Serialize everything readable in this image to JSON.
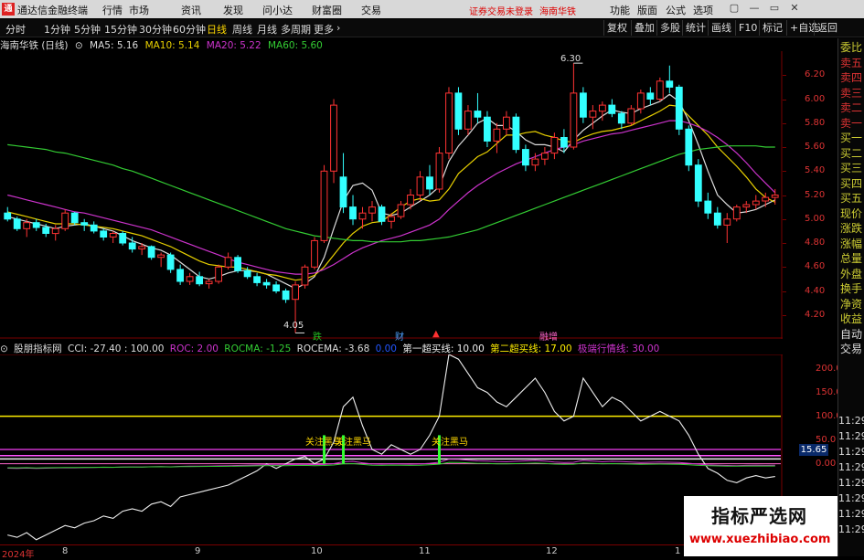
{
  "titlebar": {
    "logo_text": "通",
    "app_name": "通达信金融终端",
    "menus": [
      "行情",
      "市场",
      "资讯",
      "发现",
      "问小达",
      "财富圈",
      "交易"
    ],
    "warning": "证券交易未登录",
    "stock_title": "海南华铁",
    "right_menus": [
      "功能",
      "版面",
      "公式",
      "选项"
    ],
    "window_buttons": [
      "▢",
      "—",
      "▭",
      "✕"
    ]
  },
  "toolbar": {
    "periods": [
      "分时",
      "1分钟",
      "5分钟",
      "15分钟",
      "30分钟",
      "60分钟",
      "日线",
      "周线",
      "月线",
      "多周期",
      "更多"
    ],
    "active_period": "日线",
    "right_buttons": [
      "复权",
      "叠加",
      "多股",
      "统计",
      "画线",
      "F10",
      "标记",
      "+自选",
      "返回"
    ]
  },
  "main_info": {
    "name": "海南华铁 (日线)",
    "ma5": "MA5: 5.16",
    "ma10": "MA10: 5.14",
    "ma20": "MA20: 5.22",
    "ma60": "MA60: 5.60"
  },
  "price_axis": {
    "ticks": [
      6.2,
      6.0,
      5.8,
      5.6,
      5.4,
      5.2,
      5.0,
      4.8,
      4.6,
      4.4,
      4.2
    ],
    "tick_labels": [
      "6.20",
      "6.00",
      "5.80",
      "5.60",
      "5.40",
      "5.20",
      "5.00",
      "4.80",
      "4.60",
      "4.40",
      "4.20"
    ],
    "range": [
      4.0,
      6.4
    ]
  },
  "main_annotations": {
    "high": "6.30",
    "low": "4.05",
    "markers": [
      {
        "text": "跌",
        "color": "#22c022"
      },
      {
        "text": "财",
        "color": "#4aa0ff"
      },
      {
        "text": "▲",
        "color": "#ff3030"
      },
      {
        "text": "融增",
        "color": "#ff66cc"
      }
    ]
  },
  "indicator_info": {
    "name": "股朋指标网",
    "cci": "CCI: -27.40 : 100.00",
    "roc": "ROC: 2.00",
    "rocma": "ROCMA: -1.25",
    "rocema": "ROCEMA: -3.68",
    "val_blue": "0.00",
    "line1": "第一超买线: 10.00",
    "line2": "第二超买线: 17.00",
    "line3": "极端行情线: 30.00"
  },
  "indicator_axis": {
    "ticks": [
      200,
      150,
      100,
      50,
      0
    ],
    "tick_labels": [
      "200.0",
      "150.0",
      "100.0",
      "50.0",
      "0.00"
    ],
    "range": [
      -170,
      230
    ],
    "badge": "15.65"
  },
  "indicator_annotations": {
    "signal_label": "关注黑马"
  },
  "dates": [
    "2024年",
    "8",
    "9",
    "10",
    "11",
    "12",
    "1"
  ],
  "sidebar": {
    "labels": [
      "委比",
      "卖五",
      "卖四",
      "卖三",
      "卖二",
      "卖一",
      "买一",
      "买二",
      "买三",
      "买四",
      "买五",
      "现价",
      "涨跌",
      "涨幅",
      "总量",
      "外盘",
      "换手",
      "净资",
      "收益",
      "自动",
      "交易"
    ],
    "times": [
      "11:29",
      "11:29",
      "11:29",
      "11:29",
      "11:29",
      "11:29",
      "11:29",
      "11:29"
    ]
  },
  "watermark": {
    "title": "指标严选网",
    "url": "www.xuezhibiao.com"
  },
  "chart_data": {
    "type": "candlestick",
    "title": "海南华铁 (日线)",
    "ylim": [
      4.0,
      6.4
    ],
    "candles": [
      [
        5.05,
        5.1,
        4.98,
        5.0
      ],
      [
        5.0,
        5.02,
        4.9,
        4.92
      ],
      [
        4.92,
        5.0,
        4.85,
        4.97
      ],
      [
        4.97,
        5.0,
        4.9,
        4.93
      ],
      [
        4.93,
        4.96,
        4.85,
        4.88
      ],
      [
        4.88,
        4.95,
        4.82,
        4.92
      ],
      [
        4.92,
        5.08,
        4.9,
        5.05
      ],
      [
        5.05,
        5.06,
        4.95,
        4.97
      ],
      [
        4.97,
        5.0,
        4.9,
        4.95
      ],
      [
        4.95,
        4.98,
        4.88,
        4.9
      ],
      [
        4.9,
        4.92,
        4.82,
        4.85
      ],
      [
        4.85,
        4.9,
        4.8,
        4.88
      ],
      [
        4.88,
        4.9,
        4.78,
        4.8
      ],
      [
        4.8,
        4.85,
        4.72,
        4.75
      ],
      [
        4.75,
        4.8,
        4.7,
        4.77
      ],
      [
        4.77,
        4.78,
        4.66,
        4.68
      ],
      [
        4.68,
        4.72,
        4.6,
        4.7
      ],
      [
        4.7,
        4.72,
        4.55,
        4.58
      ],
      [
        4.58,
        4.62,
        4.45,
        4.48
      ],
      [
        4.48,
        4.55,
        4.45,
        4.52
      ],
      [
        4.52,
        4.56,
        4.44,
        4.46
      ],
      [
        4.46,
        4.5,
        4.42,
        4.48
      ],
      [
        4.48,
        4.62,
        4.46,
        4.6
      ],
      [
        4.6,
        4.72,
        4.58,
        4.68
      ],
      [
        4.68,
        4.7,
        4.55,
        4.57
      ],
      [
        4.57,
        4.6,
        4.5,
        4.52
      ],
      [
        4.52,
        4.55,
        4.44,
        4.47
      ],
      [
        4.47,
        4.5,
        4.42,
        4.45
      ],
      [
        4.45,
        4.48,
        4.38,
        4.4
      ],
      [
        4.4,
        4.42,
        4.3,
        4.33
      ],
      [
        4.33,
        4.48,
        4.05,
        4.45
      ],
      [
        4.45,
        4.62,
        4.42,
        4.6
      ],
      [
        4.6,
        4.85,
        4.58,
        4.82
      ],
      [
        4.82,
        5.45,
        4.8,
        5.4
      ],
      [
        5.4,
        6.0,
        5.3,
        5.95
      ],
      [
        5.35,
        5.55,
        5.05,
        5.1
      ],
      [
        5.1,
        5.2,
        4.95,
        5.0
      ],
      [
        5.0,
        5.1,
        4.92,
        5.05
      ],
      [
        5.05,
        5.15,
        4.98,
        5.1
      ],
      [
        5.1,
        5.12,
        4.95,
        4.98
      ],
      [
        4.98,
        5.05,
        4.92,
        5.02
      ],
      [
        5.02,
        5.15,
        5.0,
        5.12
      ],
      [
        5.12,
        5.25,
        5.08,
        5.2
      ],
      [
        5.2,
        5.4,
        5.15,
        5.35
      ],
      [
        5.35,
        5.45,
        5.2,
        5.25
      ],
      [
        5.25,
        5.6,
        5.22,
        5.55
      ],
      [
        5.55,
        6.1,
        5.5,
        6.05
      ],
      [
        6.05,
        6.1,
        5.7,
        5.75
      ],
      [
        5.75,
        5.95,
        5.7,
        5.9
      ],
      [
        5.9,
        6.05,
        5.8,
        5.85
      ],
      [
        5.85,
        5.9,
        5.6,
        5.65
      ],
      [
        5.65,
        5.8,
        5.55,
        5.75
      ],
      [
        5.75,
        5.9,
        5.7,
        5.85
      ],
      [
        5.85,
        5.88,
        5.55,
        5.58
      ],
      [
        5.58,
        5.62,
        5.4,
        5.45
      ],
      [
        5.45,
        5.55,
        5.4,
        5.5
      ],
      [
        5.5,
        5.6,
        5.45,
        5.55
      ],
      [
        5.55,
        5.72,
        5.5,
        5.68
      ],
      [
        5.68,
        5.75,
        5.55,
        5.6
      ],
      [
        5.6,
        6.3,
        5.58,
        6.05
      ],
      [
        6.05,
        6.1,
        5.8,
        5.85
      ],
      [
        5.85,
        5.95,
        5.75,
        5.9
      ],
      [
        5.9,
        5.98,
        5.82,
        5.95
      ],
      [
        5.95,
        6.0,
        5.85,
        5.88
      ],
      [
        5.88,
        5.9,
        5.75,
        5.8
      ],
      [
        5.8,
        5.95,
        5.78,
        5.92
      ],
      [
        5.92,
        6.08,
        5.88,
        6.05
      ],
      [
        6.05,
        6.1,
        5.95,
        6.0
      ],
      [
        6.0,
        6.18,
        5.98,
        6.15
      ],
      [
        6.15,
        6.28,
        6.05,
        6.1
      ],
      [
        6.1,
        6.12,
        5.7,
        5.75
      ],
      [
        5.75,
        5.78,
        5.4,
        5.45
      ],
      [
        5.45,
        5.5,
        5.1,
        5.15
      ],
      [
        5.15,
        5.22,
        5.0,
        5.05
      ],
      [
        5.05,
        5.1,
        4.92,
        4.95
      ],
      [
        4.95,
        5.05,
        4.8,
        5.0
      ],
      [
        5.0,
        5.12,
        4.98,
        5.1
      ],
      [
        5.1,
        5.15,
        5.05,
        5.12
      ],
      [
        5.12,
        5.2,
        5.08,
        5.15
      ],
      [
        5.15,
        5.22,
        5.1,
        5.18
      ],
      [
        5.18,
        5.25,
        5.12,
        5.2
      ]
    ],
    "ma_series": [
      {
        "name": "MA5",
        "color": "#dddddd",
        "values": [
          5.02,
          5.0,
          4.98,
          4.96,
          4.94,
          4.92,
          4.94,
          4.95,
          4.96,
          4.94,
          4.92,
          4.9,
          4.86,
          4.82,
          4.79,
          4.76,
          4.74,
          4.7,
          4.64,
          4.58,
          4.52,
          4.5,
          4.52,
          4.55,
          4.57,
          4.57,
          4.56,
          4.54,
          4.5,
          4.46,
          4.42,
          4.46,
          4.52,
          4.68,
          4.92,
          5.15,
          5.28,
          5.3,
          5.24,
          5.05,
          5.03,
          5.05,
          5.1,
          5.15,
          5.2,
          5.27,
          5.48,
          5.61,
          5.7,
          5.8,
          5.84,
          5.78,
          5.78,
          5.73,
          5.66,
          5.62,
          5.62,
          5.6,
          5.56,
          5.66,
          5.74,
          5.8,
          5.86,
          5.91,
          5.89,
          5.88,
          5.92,
          5.95,
          5.98,
          6.04,
          5.98,
          5.82,
          5.62,
          5.4,
          5.2,
          5.12,
          5.05,
          5.06,
          5.08,
          5.12,
          5.16
        ]
      },
      {
        "name": "MA10",
        "color": "#e8d000",
        "values": [
          5.06,
          5.04,
          5.02,
          5.0,
          4.98,
          4.96,
          4.96,
          4.96,
          4.95,
          4.94,
          4.93,
          4.92,
          4.9,
          4.88,
          4.86,
          4.83,
          4.8,
          4.77,
          4.73,
          4.69,
          4.65,
          4.62,
          4.61,
          4.6,
          4.6,
          4.58,
          4.56,
          4.54,
          4.53,
          4.51,
          4.49,
          4.5,
          4.53,
          4.6,
          4.7,
          4.8,
          4.88,
          4.94,
          4.97,
          4.98,
          5.04,
          5.1,
          5.15,
          5.17,
          5.15,
          5.16,
          5.25,
          5.38,
          5.45,
          5.52,
          5.56,
          5.63,
          5.7,
          5.7,
          5.72,
          5.73,
          5.7,
          5.68,
          5.65,
          5.64,
          5.68,
          5.71,
          5.73,
          5.74,
          5.76,
          5.78,
          5.82,
          5.86,
          5.9,
          5.95,
          5.94,
          5.86,
          5.78,
          5.7,
          5.6,
          5.52,
          5.44,
          5.35,
          5.25,
          5.18,
          5.14
        ]
      },
      {
        "name": "MA20",
        "color": "#cc33cc",
        "values": [
          5.2,
          5.18,
          5.16,
          5.14,
          5.12,
          5.1,
          5.08,
          5.06,
          5.05,
          5.03,
          5.01,
          4.99,
          4.97,
          4.95,
          4.93,
          4.91,
          4.88,
          4.85,
          4.82,
          4.79,
          4.76,
          4.73,
          4.7,
          4.67,
          4.64,
          4.62,
          4.6,
          4.58,
          4.56,
          4.55,
          4.54,
          4.54,
          4.55,
          4.58,
          4.62,
          4.67,
          4.72,
          4.76,
          4.79,
          4.82,
          4.84,
          4.86,
          4.89,
          4.92,
          4.95,
          5.0,
          5.08,
          5.15,
          5.22,
          5.28,
          5.33,
          5.38,
          5.42,
          5.46,
          5.49,
          5.52,
          5.55,
          5.58,
          5.6,
          5.62,
          5.65,
          5.67,
          5.69,
          5.71,
          5.72,
          5.74,
          5.76,
          5.78,
          5.8,
          5.82,
          5.82,
          5.8,
          5.77,
          5.73,
          5.68,
          5.62,
          5.55,
          5.47,
          5.38,
          5.3,
          5.22
        ]
      },
      {
        "name": "MA60",
        "color": "#33cc33",
        "values": [
          5.62,
          5.61,
          5.6,
          5.59,
          5.58,
          5.56,
          5.55,
          5.53,
          5.51,
          5.49,
          5.47,
          5.45,
          5.42,
          5.4,
          5.37,
          5.34,
          5.31,
          5.28,
          5.25,
          5.22,
          5.19,
          5.16,
          5.13,
          5.1,
          5.07,
          5.04,
          5.01,
          4.98,
          4.95,
          4.92,
          4.9,
          4.88,
          4.86,
          4.85,
          4.84,
          4.83,
          4.82,
          4.82,
          4.81,
          4.81,
          4.81,
          4.81,
          4.82,
          4.82,
          4.83,
          4.84,
          4.85,
          4.87,
          4.89,
          4.91,
          4.94,
          4.97,
          5.0,
          5.03,
          5.06,
          5.09,
          5.12,
          5.15,
          5.18,
          5.21,
          5.24,
          5.27,
          5.3,
          5.33,
          5.36,
          5.39,
          5.42,
          5.45,
          5.48,
          5.51,
          5.54,
          5.56,
          5.58,
          5.59,
          5.6,
          5.61,
          5.61,
          5.61,
          5.61,
          5.6,
          5.6
        ]
      }
    ],
    "indicator": {
      "cci": [
        -150,
        -155,
        -145,
        -160,
        -150,
        -140,
        -130,
        -135,
        -125,
        -120,
        -110,
        -115,
        -100,
        -95,
        -100,
        -85,
        -80,
        -90,
        -70,
        -65,
        -60,
        -55,
        -50,
        -45,
        -35,
        -25,
        -15,
        0,
        -10,
        0,
        10,
        15,
        0,
        10,
        45,
        120,
        140,
        80,
        30,
        20,
        40,
        30,
        20,
        30,
        60,
        100,
        230,
        220,
        190,
        160,
        150,
        130,
        120,
        140,
        160,
        180,
        150,
        110,
        90,
        100,
        180,
        150,
        120,
        140,
        130,
        110,
        90,
        100,
        110,
        100,
        90,
        60,
        20,
        -10,
        -20,
        -35,
        -40,
        -30,
        -25,
        -30,
        -27
      ],
      "overbought_lines": [
        10,
        17,
        30
      ],
      "reference_line": 100
    }
  }
}
